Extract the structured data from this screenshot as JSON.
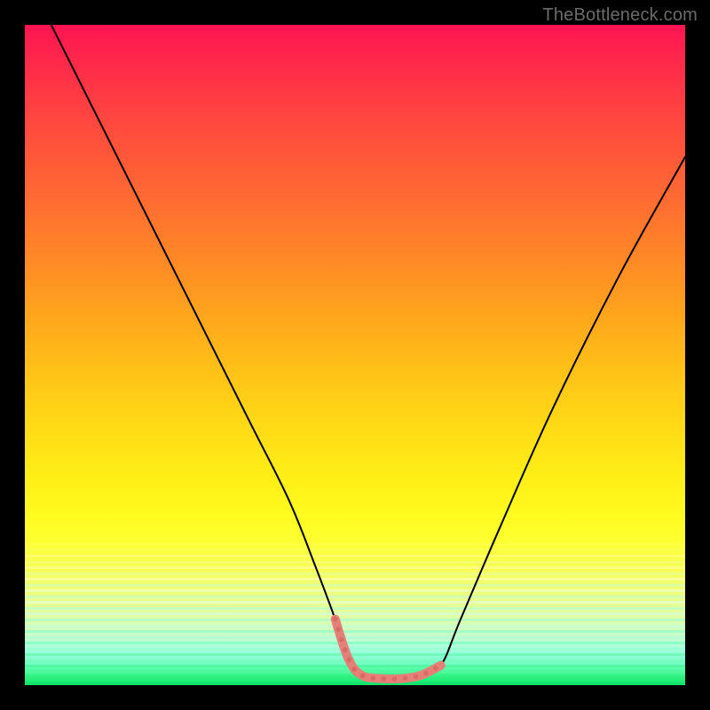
{
  "watermark": "TheBottleneck.com",
  "chart_data": {
    "type": "line",
    "title": "",
    "xlabel": "",
    "ylabel": "",
    "xlim": [
      0,
      100
    ],
    "ylim": [
      0,
      100
    ],
    "grid": false,
    "legend": false,
    "series": [
      {
        "name": "black-curve",
        "color": "#000000",
        "width": 2,
        "x": [
          4,
          10,
          18,
          26,
          34,
          40,
          44,
          47,
          49,
          51,
          54,
          57,
          60,
          63,
          66,
          72,
          80,
          90,
          100
        ],
        "values": [
          100,
          88,
          72,
          56,
          40,
          28,
          18,
          10,
          4,
          1.5,
          1,
          1,
          1.5,
          3,
          10,
          24,
          42,
          62,
          80
        ]
      },
      {
        "name": "pink-highlight",
        "color": "#e57f78",
        "width": 10,
        "x": [
          47,
          49,
          51,
          54,
          57,
          60,
          63
        ],
        "values": [
          10,
          4,
          1.5,
          1,
          1,
          1.5,
          3
        ]
      }
    ],
    "annotations": []
  }
}
